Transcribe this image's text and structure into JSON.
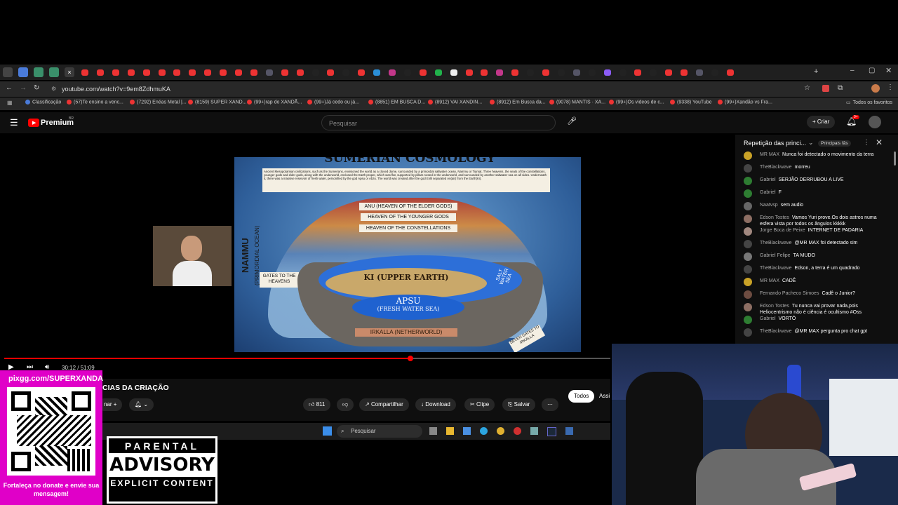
{
  "browser": {
    "url": "youtube.com/watch?v=9em8ZdhmuKA",
    "all_bookmarks": "Todos os favoritos",
    "bookmarks": [
      "Classificação",
      "(57)Te ensino a venc...",
      "(7292) Enéas Metal |...",
      "(8159) SUPER XAND...",
      "(99+)rap do XANDÃ...",
      "(99+)Já cedo ou já...",
      "(8851) EM BUSCA D...",
      "(8912) VAI XANDIN...",
      "(8912) Em Busca da...",
      "(9078) MANTIS · XA...",
      "(99+)Os videos de c...",
      "(9338) YouTube",
      "(99+)Xandão vs Fra..."
    ]
  },
  "youtube": {
    "logo": "Premium",
    "logo_sup": "BR",
    "search_placeholder": "Pesquisar",
    "create_label": "Criar",
    "notif_count": "9+",
    "progress": 0.67,
    "time": "30:12 / 51:09",
    "title": "CIAS DA CRIAÇÃO",
    "subscribe_fragment": "nar",
    "like_count": "811",
    "share": "Compartilhar",
    "download": "Download",
    "clip": "Clipe",
    "save": "Salvar",
    "chip_all": "Todos",
    "chip_next": "Assi"
  },
  "slide": {
    "title": "SUMERIAN COSMOLOGY",
    "intro": "Ancient Mesopotamian civilizations, such as the Sumerians, envisioned the world as a closed dome, surrounded by a primordial saltwater ocean, Nammu or Tiamat. Three heavens, the seats of the constellations, younger gods and elder gods, along with the underworld, enclosed the Earth proper, which was flat, supported by pillars rooted in the underworld, and surrounded by another saltwater sea on all sides. Underneath it, there was a massive reservoir of fresh water, personified by the god Apsu or Abzu. The world was created after the god Enlil separated An(air) from the Earth(Ki).",
    "nammu": "NAMMU",
    "nammu_sub": "(PRIMORDIAL OCEAN)",
    "anu": "ANU (HEAVEN OF THE ELDER GODS)",
    "younger": "HEAVEN OF THE YOUNGER GODS",
    "constellations": "HEAVEN OF THE CONSTELLATIONS",
    "gates": "GATES TO THE HEAVENS",
    "ki": "KI (UPPER EARTH)",
    "apsu": "APSU",
    "apsu_sub": "(FRESH WATER SEA)",
    "salt": "SALT WATER SEA",
    "irkalla": "IRKALLA (NETHERWORLD)",
    "seven_gates": "SEVEN GATES TO IRKALLA"
  },
  "chat": {
    "header": "Repetição das princi...",
    "badge": "Principais fãs",
    "messages": [
      {
        "author": "MR MAX",
        "text": "Nunca foi detectado o movimento da terra",
        "color": "#c9a227"
      },
      {
        "author": "TheBlackwave",
        "text": "morreu",
        "color": "#444444"
      },
      {
        "author": "Gabriel",
        "text": "SERJÃO DERRUBOU A LIVE",
        "color": "#2e7d32"
      },
      {
        "author": "Gabriel",
        "text": "F",
        "color": "#2e7d32"
      },
      {
        "author": "Naatvsp",
        "text": "sem audio",
        "color": "#666666"
      },
      {
        "author": "Edson Tostes",
        "text": "Vamos Yuri prove.Os dois astros numa esfera vista por todos os ângulos kkkkk",
        "color": "#8d6e63"
      },
      {
        "author": "Jorge Boca de Peixe",
        "text": "INTERNET DE PADARIA",
        "color": "#a1887f"
      },
      {
        "author": "TheBlackwave",
        "text": "@MR MAX foi detectado sim",
        "color": "#444444"
      },
      {
        "author": "Gabriel Felipe",
        "text": "TA MUDO",
        "color": "#777777"
      },
      {
        "author": "TheBlackwave",
        "text": "Edson, a terra é um quadrado",
        "color": "#444444"
      },
      {
        "author": "MR MAX",
        "text": "CADÊ",
        "color": "#c9a227"
      },
      {
        "author": "Fernando Pacheco Simoes",
        "text": "Cadê o Junior?",
        "color": "#6d4c41"
      },
      {
        "author": "Edson Tostes",
        "text": "Tu nunca vai provar nada,pois Heliocentrismo não é ciência é ocultismo #Oss",
        "color": "#8d6e63"
      },
      {
        "author": "Gabriel",
        "text": "VORTÓ",
        "color": "#2e7d32"
      },
      {
        "author": "TheBlackwave",
        "text": "@MR MAX pergunta pro chat gpt",
        "color": "#444444"
      }
    ]
  },
  "taskbar": {
    "search": "Pesquisar"
  },
  "overlay": {
    "pix_url": "pixgg.com/SUPERXANDA",
    "pix_cta": "Fortaleça no donate e envie sua mensagem!",
    "advisory_top": "PARENTAL",
    "advisory_mid": "ADVISORY",
    "advisory_bottom": "EXPLICIT CONTENT"
  }
}
